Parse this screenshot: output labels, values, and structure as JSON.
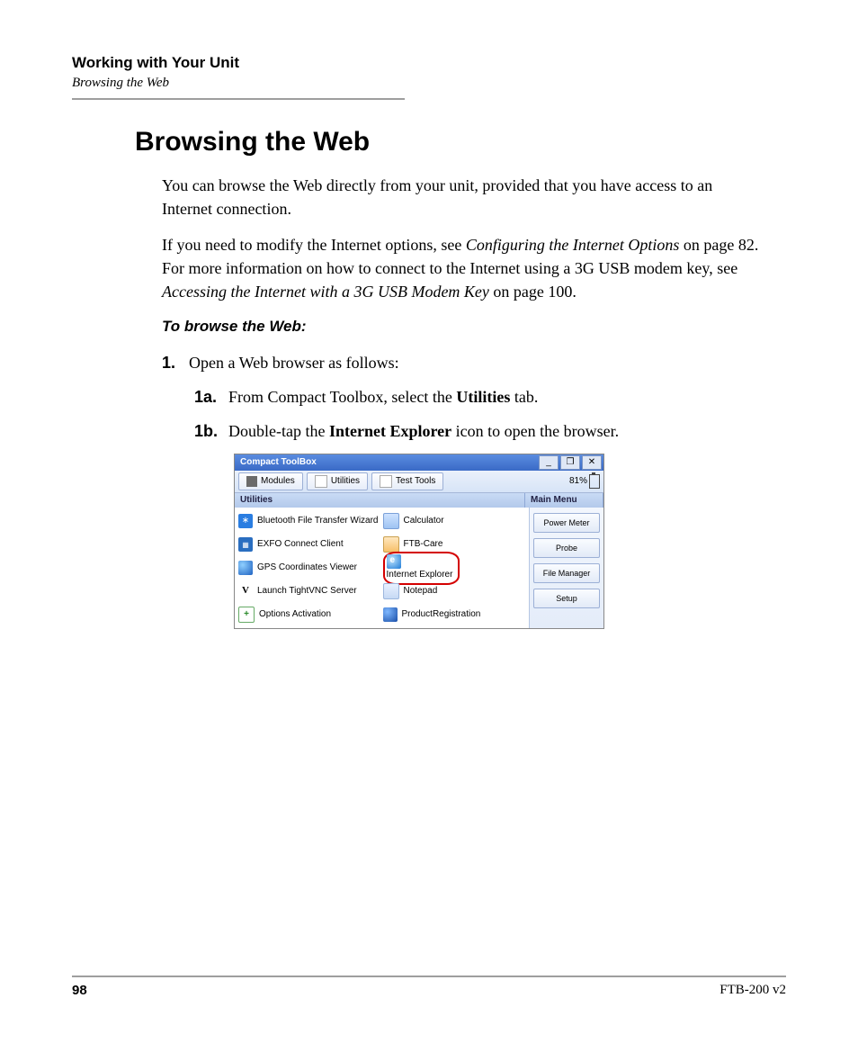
{
  "header": {
    "chapter": "Working with Your Unit",
    "section": "Browsing the Web"
  },
  "title": "Browsing the Web",
  "para1": "You can browse the Web directly from your unit, provided that you have access to an Internet connection.",
  "para2_a": "If you need to modify the Internet options, see ",
  "para2_ref1": "Configuring the Internet Options",
  "para2_b": " on page 82. For more information on how to connect to the Internet using a 3G USB modem key, see ",
  "para2_ref2": "Accessing the Internet with a 3G USB Modem Key",
  "para2_c": " on page 100.",
  "proc_head": "To browse the Web:",
  "step1_num": "1.",
  "step1_txt": "Open a Web browser as follows:",
  "step1a_num": "1a.",
  "step1a_a": "From Compact Toolbox, select the ",
  "step1a_b": "Utilities",
  "step1a_c": " tab.",
  "step1b_num": "1b.",
  "step1b_a": "Double-tap the ",
  "step1b_b": "Internet Explorer",
  "step1b_c": " icon to open the browser.",
  "screenshot": {
    "window_title": "Compact ToolBox",
    "win_min": "_",
    "win_max": "❐",
    "win_close": "✕",
    "tabs": {
      "modules": "Modules",
      "utilities": "Utilities",
      "testtools": "Test Tools"
    },
    "battery": "81%",
    "subtab_left": "Utilities",
    "subtab_right": "Main Menu",
    "left_items": [
      "Bluetooth File Transfer Wizard",
      "EXFO Connect Client",
      "GPS Coordinates Viewer",
      "Launch TightVNC Server",
      "Options Activation"
    ],
    "right_items": [
      "Calculator",
      "FTB-Care",
      "Internet Explorer",
      "Notepad",
      "ProductRegistration"
    ],
    "side_buttons": [
      "Power Meter",
      "Probe",
      "File Manager",
      "Setup"
    ]
  },
  "footer": {
    "page": "98",
    "model": "FTB-200 v2"
  }
}
